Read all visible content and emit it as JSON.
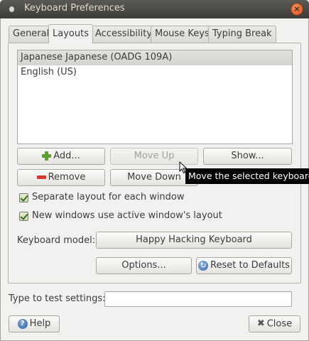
{
  "window": {
    "title": "Keyboard Preferences",
    "close_symbol": "×"
  },
  "tabs": [
    {
      "label": "General",
      "active": false
    },
    {
      "label": "Layouts",
      "active": true
    },
    {
      "label": "Accessibility",
      "active": false
    },
    {
      "label": "Mouse Keys",
      "active": false
    },
    {
      "label": "Typing Break",
      "active": false
    }
  ],
  "layouts": [
    {
      "label": "Japanese Japanese (OADG 109A)",
      "selected": true
    },
    {
      "label": "English (US)",
      "selected": false
    }
  ],
  "buttons": {
    "add": "Add...",
    "move_up": "Move Up",
    "show": "Show...",
    "remove": "Remove",
    "move_down": "Move Down",
    "keyboard_model_value": "Happy Hacking Keyboard",
    "options": "Options...",
    "reset": "Reset to Defaults",
    "help": "Help",
    "close": "Close"
  },
  "checkboxes": {
    "separate_layout": {
      "label": "Separate layout for each window",
      "checked": true
    },
    "new_windows_active": {
      "label": "New windows use active window's layout",
      "checked": true
    }
  },
  "keyboard_model_label": "Keyboard model:",
  "test_settings": {
    "label": "Type to test settings:",
    "value": ""
  },
  "tooltip": "Move the selected keyboard layout down in the list",
  "icons": {
    "help_glyph": "?",
    "reset_glyph": "↻",
    "close_glyph": "✖"
  },
  "colors": {
    "titlebar": "#3d3c38",
    "close_button": "#d9531e",
    "add_icon": "#5aa02c",
    "remove_icon": "#d9382e"
  }
}
